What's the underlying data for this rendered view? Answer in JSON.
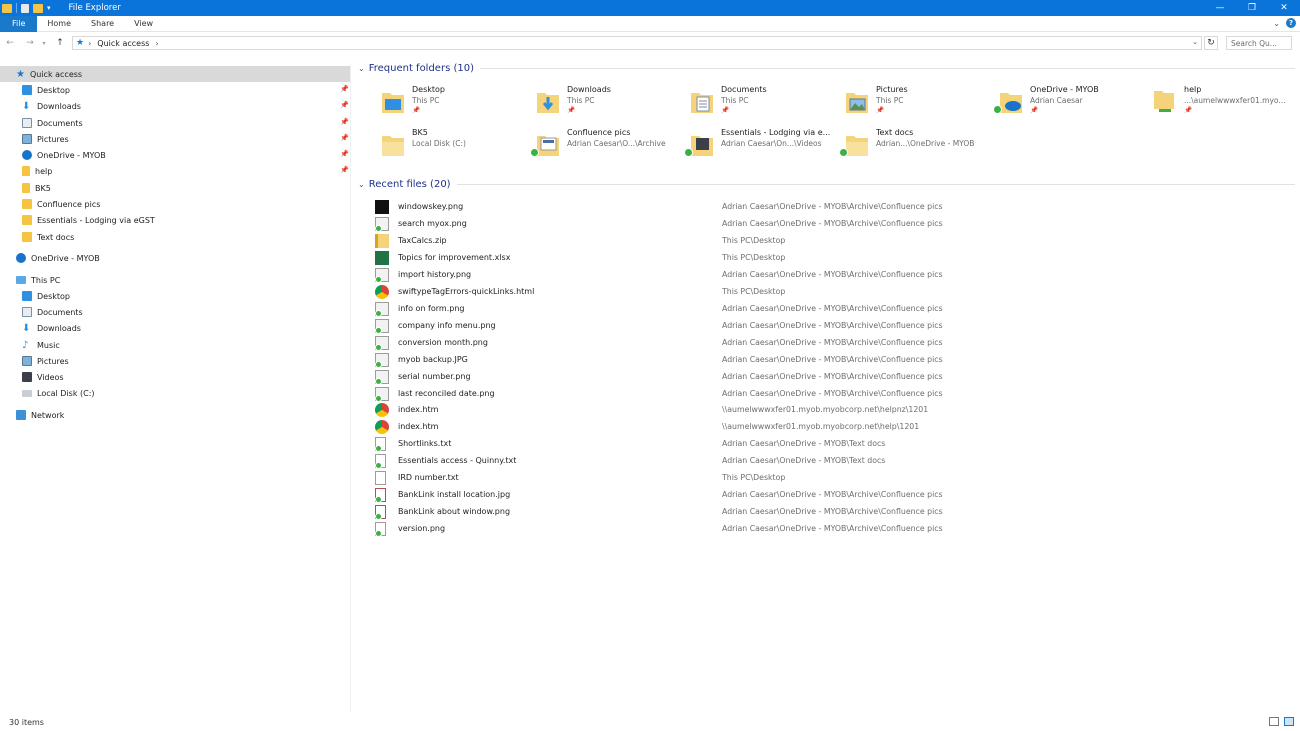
{
  "window": {
    "title": "File Explorer"
  },
  "ribbon": {
    "tabs": [
      "File",
      "Home",
      "Share",
      "View"
    ]
  },
  "address": {
    "path": "Quick access",
    "search_placeholder": "Search Qu..."
  },
  "nav": {
    "quick_access": "Quick access",
    "quick_items": [
      "Desktop",
      "Downloads",
      "Documents",
      "Pictures",
      "OneDrive - MYOB",
      "help",
      "BK5",
      "Confluence pics",
      "Essentials - Lodging via eGST",
      "Text docs"
    ],
    "onedrive": "OneDrive - MYOB",
    "this_pc": "This PC",
    "pc_items": [
      "Desktop",
      "Documents",
      "Downloads",
      "Music",
      "Pictures",
      "Videos",
      "Local Disk (C:)"
    ],
    "network": "Network"
  },
  "frequent": {
    "heading": "Frequent folders (10)",
    "folders": [
      {
        "name": "Desktop",
        "sub": "This PC"
      },
      {
        "name": "Downloads",
        "sub": "This PC"
      },
      {
        "name": "Documents",
        "sub": "This PC"
      },
      {
        "name": "Pictures",
        "sub": "This PC"
      },
      {
        "name": "OneDrive - MYOB",
        "sub": "Adrian Caesar"
      },
      {
        "name": "help",
        "sub": "...\\aumelwwwxfer01.myo..."
      },
      {
        "name": "BK5",
        "sub": "Local Disk (C:)"
      },
      {
        "name": "Confluence pics",
        "sub": "Adrian Caesar\\O...\\Archive"
      },
      {
        "name": "Essentials - Lodging via e...",
        "sub": "Adrian Caesar\\On...\\Videos"
      },
      {
        "name": "Text docs",
        "sub": "Adrian...\\OneDrive - MYOB"
      }
    ]
  },
  "recent": {
    "heading": "Recent files (20)",
    "files": [
      {
        "name": "windowskey.png",
        "path": "Adrian Caesar\\OneDrive - MYOB\\Archive\\Confluence pics"
      },
      {
        "name": "search myox.png",
        "path": "Adrian Caesar\\OneDrive - MYOB\\Archive\\Confluence pics"
      },
      {
        "name": "TaxCalcs.zip",
        "path": "This PC\\Desktop"
      },
      {
        "name": "Topics for improvement.xlsx",
        "path": "This PC\\Desktop"
      },
      {
        "name": "import history.png",
        "path": "Adrian Caesar\\OneDrive - MYOB\\Archive\\Confluence pics"
      },
      {
        "name": "swiftypeTagErrors-quickLinks.html",
        "path": "This PC\\Desktop"
      },
      {
        "name": "info on form.png",
        "path": "Adrian Caesar\\OneDrive - MYOB\\Archive\\Confluence pics"
      },
      {
        "name": "company info menu.png",
        "path": "Adrian Caesar\\OneDrive - MYOB\\Archive\\Confluence pics"
      },
      {
        "name": "conversion month.png",
        "path": "Adrian Caesar\\OneDrive - MYOB\\Archive\\Confluence pics"
      },
      {
        "name": "myob backup.JPG",
        "path": "Adrian Caesar\\OneDrive - MYOB\\Archive\\Confluence pics"
      },
      {
        "name": "serial number.png",
        "path": "Adrian Caesar\\OneDrive - MYOB\\Archive\\Confluence pics"
      },
      {
        "name": "last reconciled date.png",
        "path": "Adrian Caesar\\OneDrive - MYOB\\Archive\\Confluence pics"
      },
      {
        "name": "index.htm",
        "path": "\\\\aumelwwwxfer01.myob.myobcorp.net\\helpnz\\1201"
      },
      {
        "name": "index.htm",
        "path": "\\\\aumelwwwxfer01.myob.myobcorp.net\\help\\1201"
      },
      {
        "name": "Shortlinks.txt",
        "path": "Adrian Caesar\\OneDrive - MYOB\\Text docs"
      },
      {
        "name": "Essentials access - Quinny.txt",
        "path": "Adrian Caesar\\OneDrive - MYOB\\Text docs"
      },
      {
        "name": "IRD number.txt",
        "path": "This PC\\Desktop"
      },
      {
        "name": "BankLink install location.jpg",
        "path": "Adrian Caesar\\OneDrive - MYOB\\Archive\\Confluence pics"
      },
      {
        "name": "BankLink about window.png",
        "path": "Adrian Caesar\\OneDrive - MYOB\\Archive\\Confluence pics"
      },
      {
        "name": "version.png",
        "path": "Adrian Caesar\\OneDrive - MYOB\\Archive\\Confluence pics"
      }
    ]
  },
  "status": {
    "items": "30 items"
  }
}
